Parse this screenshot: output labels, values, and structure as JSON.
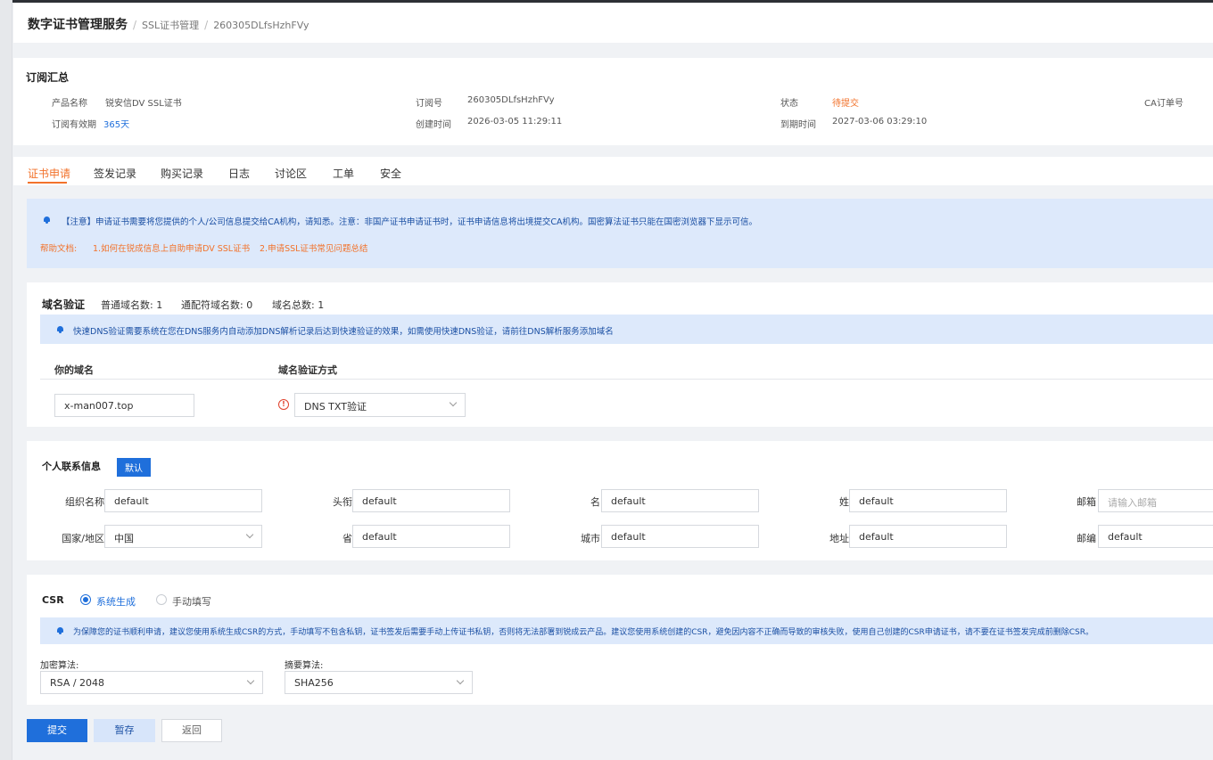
{
  "breadcrumb": {
    "root": "数字证书管理服务",
    "level2": "SSL证书管理",
    "level3": "260305DLfsHzhFVy"
  },
  "summary": {
    "title": "订阅汇总",
    "product_label": "产品名称",
    "product_value": "锐安信DV SSL证书",
    "order_label": "订阅号",
    "order_value": "260305DLfsHzhFVy",
    "status_label": "状态",
    "status_value": "待提交",
    "ca_label": "CA订单号",
    "validity_label": "订阅有效期",
    "validity_value": "365天",
    "created_label": "创建时间",
    "created_value": "2026-03-05 11:29:11",
    "expire_label": "到期时间",
    "expire_value": "2027-03-06 03:29:10"
  },
  "tabs": [
    {
      "label": "证书申请",
      "active": true
    },
    {
      "label": "签发记录"
    },
    {
      "label": "购买记录"
    },
    {
      "label": "日志"
    },
    {
      "label": "讨论区"
    },
    {
      "label": "工单"
    },
    {
      "label": "安全"
    }
  ],
  "notice": {
    "text": "【注意】申请证书需要将您提供的个人/公司信息提交给CA机构，请知悉。注意：非国产证书申请证书时，证书申请信息将出境提交CA机构。国密算法证书只能在国密浏览器下显示可信。",
    "help_prefix": "帮助文档: ",
    "help_link1": "1.如何在锐成信息上自助申请DV SSL证书",
    "help_link2": "2.申请SSL证书常见问题总结"
  },
  "domain": {
    "title": "域名验证",
    "normal_count": "普通域名数: 1",
    "wildcard_count": "通配符域名数: 0",
    "total_count": "域名总数: 1",
    "tip": "快速DNS验证需要系统在您在DNS服务内自动添加DNS解析记录后达到快速验证的效果，如需使用快速DNS验证，请前往DNS解析服务添加域名",
    "col_domain": "你的域名",
    "col_method": "域名验证方式",
    "domain_value": "x-man007.top",
    "method_value": "DNS TXT验证"
  },
  "contact": {
    "title": "个人联系信息",
    "default_tag": "默认",
    "org_label": "组织名称",
    "org_value": "default",
    "title_label": "头衔",
    "title_value": "default",
    "first_label": "名",
    "first_value": "default",
    "last_label": "姓",
    "last_value": "default",
    "email_label": "邮箱",
    "email_placeholder": "请输入邮箱",
    "country_label": "国家/地区",
    "country_value": "中国",
    "province_label": "省",
    "province_value": "default",
    "city_label": "城市",
    "city_value": "default",
    "address_label": "地址",
    "address_value": "default",
    "zip_label": "邮编",
    "zip_value": "default"
  },
  "csr": {
    "title": "CSR",
    "option_system": "系统生成",
    "option_manual": "手动填写",
    "tip": "为保障您的证书顺利申请，建议您使用系统生成CSR的方式，手动填写不包含私钥，证书签发后需要手动上传证书私钥，否则将无法部署到锐成云产品。建议您使用系统创建的CSR，避免因内容不正确而导致的审核失败，使用自己创建的CSR申请证书，请不要在证书签发完成前删除CSR。",
    "enc_label": "加密算法:",
    "enc_value": "RSA / 2048",
    "digest_label": "摘要算法:",
    "digest_value": "SHA256"
  },
  "actions": {
    "submit": "提交",
    "save": "暂存",
    "back": "返回"
  },
  "colors": {
    "primary": "#1f6fdb",
    "accent": "#f2722b",
    "notice_bg": "#dde9fb",
    "warning": "#e0402b"
  }
}
